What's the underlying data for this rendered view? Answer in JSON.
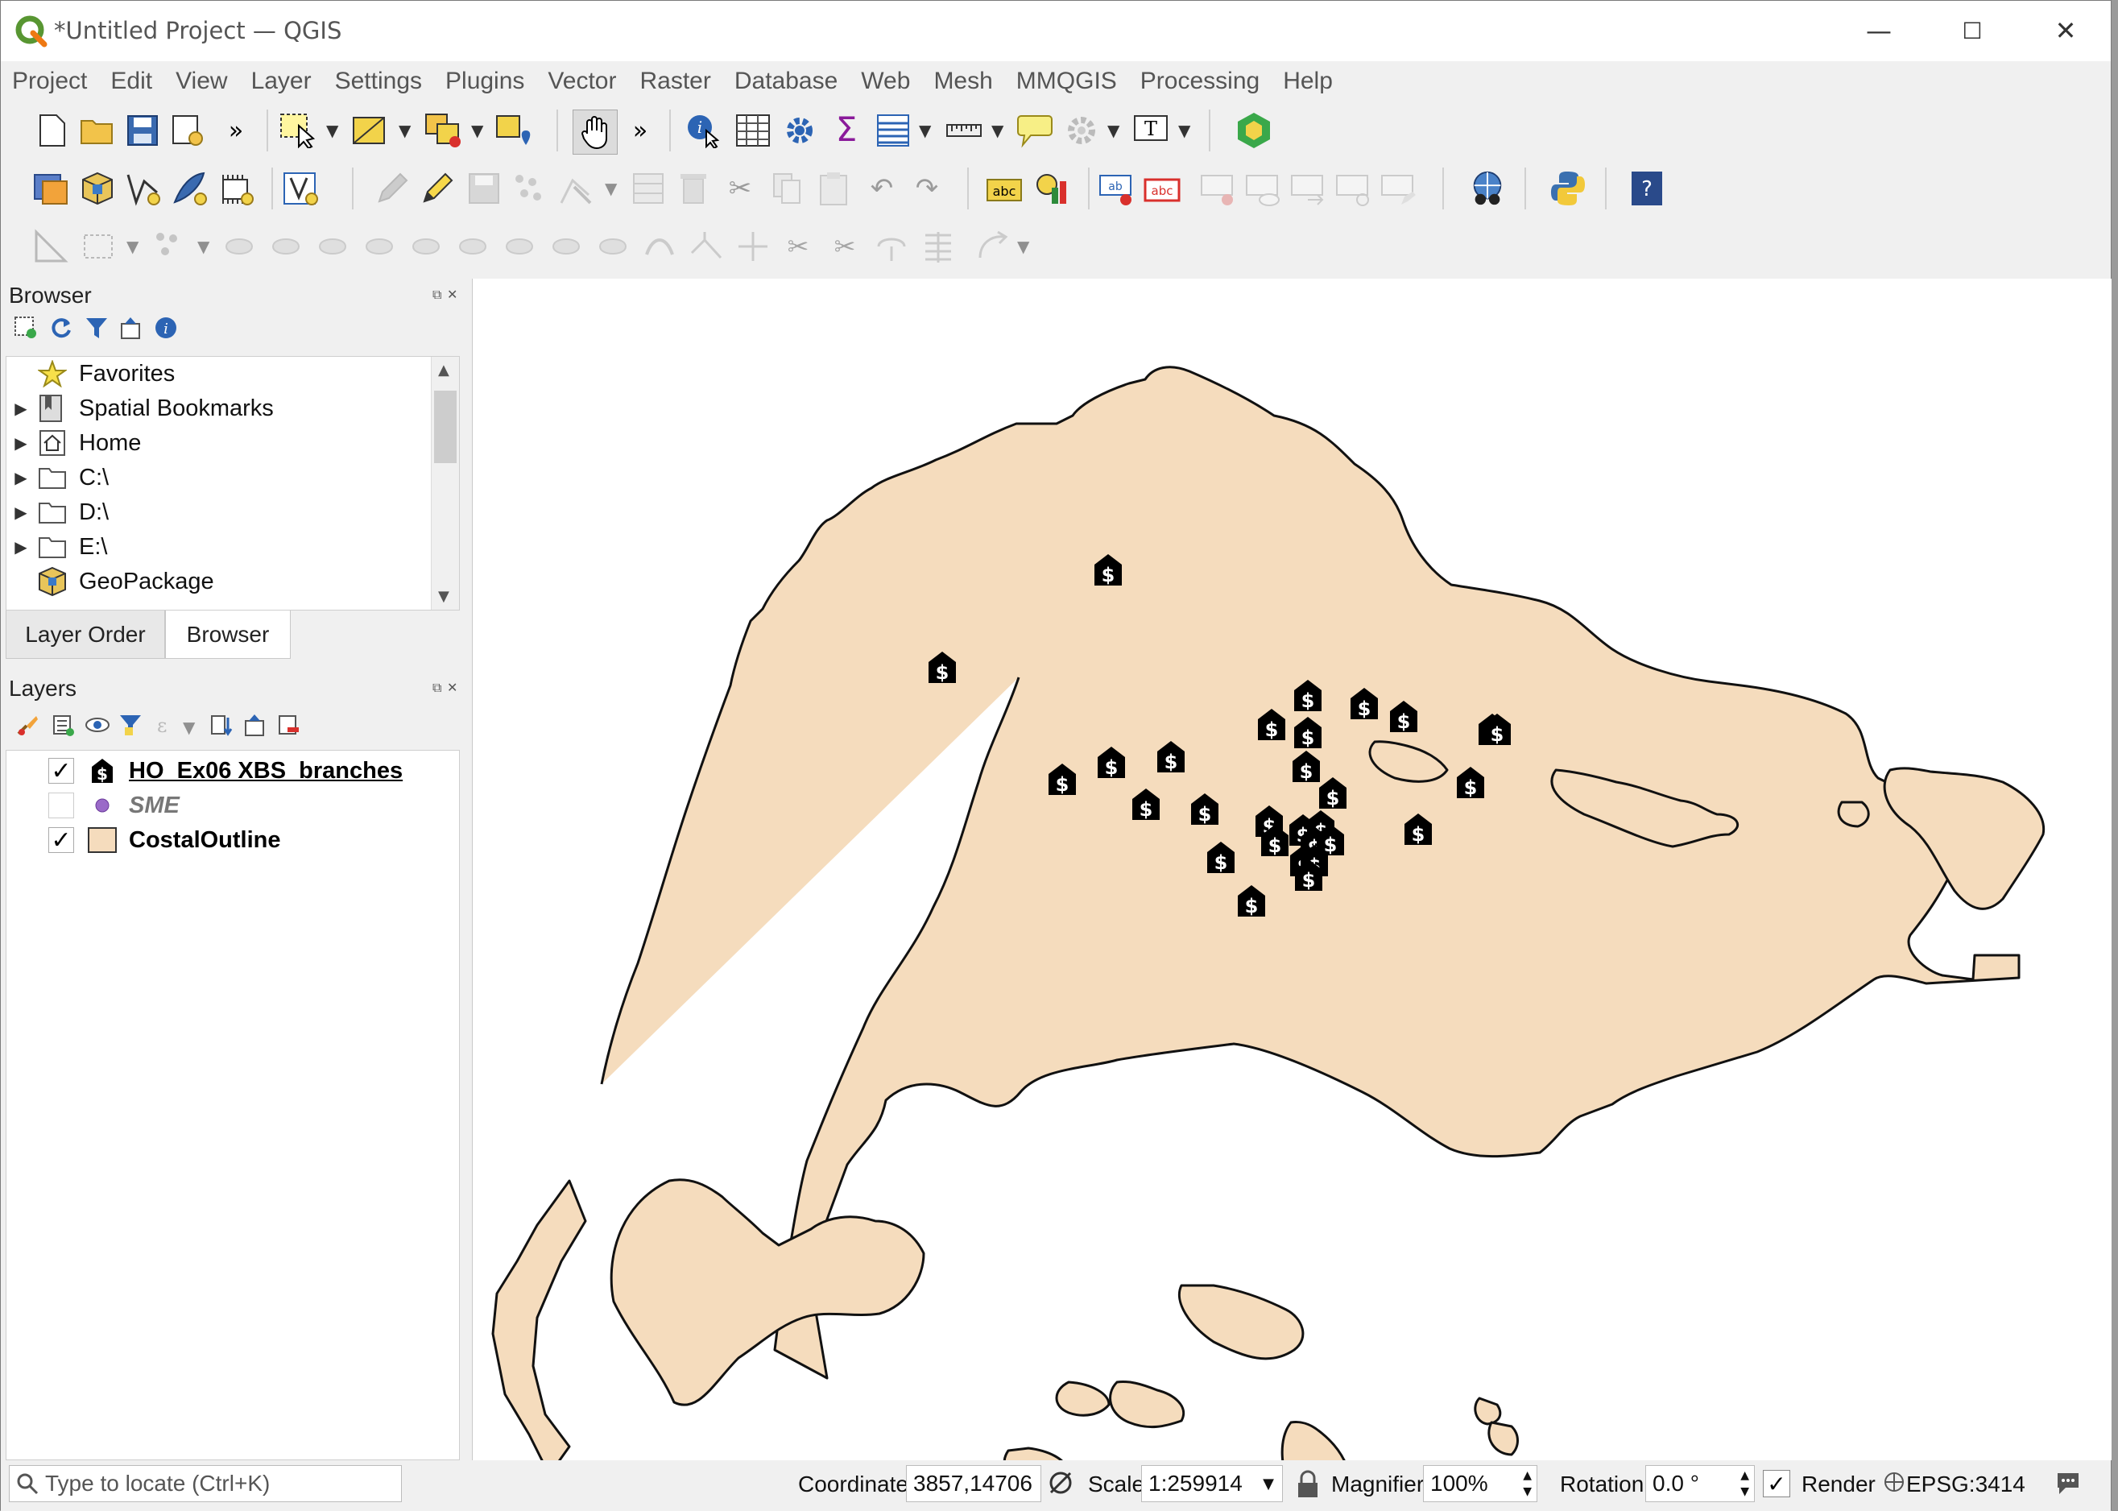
{
  "window": {
    "title": "*Untitled Project — QGIS",
    "minimize": "—",
    "maximize": "☐",
    "close": "✕"
  },
  "menubar": [
    "Project",
    "Edit",
    "View",
    "Layer",
    "Settings",
    "Plugins",
    "Vector",
    "Raster",
    "Database",
    "Web",
    "Mesh",
    "MMQGIS",
    "Processing",
    "Help"
  ],
  "browser": {
    "title": "Browser",
    "items": [
      {
        "label": "Favorites",
        "icon": "star-icon",
        "expandable": false
      },
      {
        "label": "Spatial Bookmarks",
        "icon": "bookmarks-icon",
        "expandable": true
      },
      {
        "label": "Home",
        "icon": "home-icon",
        "expandable": true
      },
      {
        "label": "C:\\",
        "icon": "folder-icon",
        "expandable": true
      },
      {
        "label": "D:\\",
        "icon": "folder-icon",
        "expandable": true
      },
      {
        "label": "E:\\",
        "icon": "folder-icon",
        "expandable": true
      },
      {
        "label": "GeoPackage",
        "icon": "geopackage-icon",
        "expandable": false
      }
    ]
  },
  "tabs": {
    "layer_order": "Layer Order",
    "browser": "Browser"
  },
  "layers": {
    "title": "Layers",
    "items": [
      {
        "name": "HO_Ex06 XBS_branches",
        "checked": true,
        "symbol": "dollar-house-icon",
        "style": "bold-underline"
      },
      {
        "name": "SME",
        "checked": false,
        "symbol": "purple-dot-icon",
        "style": "italic-grey"
      },
      {
        "name": "CostalOutline",
        "checked": true,
        "symbol": "fill-swatch-icon",
        "style": "bold"
      }
    ]
  },
  "map": {
    "fill_color": "#f5dcbd",
    "stroke_color": "#111111",
    "marker_icon": "dollar-house-icon"
  },
  "statusbar": {
    "locate_placeholder": "Type to locate (Ctrl+K)",
    "coordinate_label": "Coordinate",
    "coordinate_value": "3857,14706",
    "scale_label": "Scale",
    "scale_value": "1:259914",
    "magnifier_label": "Magnifier",
    "magnifier_value": "100%",
    "rotation_label": "Rotation",
    "rotation_value": "0.0 °",
    "render_label": "Render",
    "crs": "EPSG:3414"
  }
}
